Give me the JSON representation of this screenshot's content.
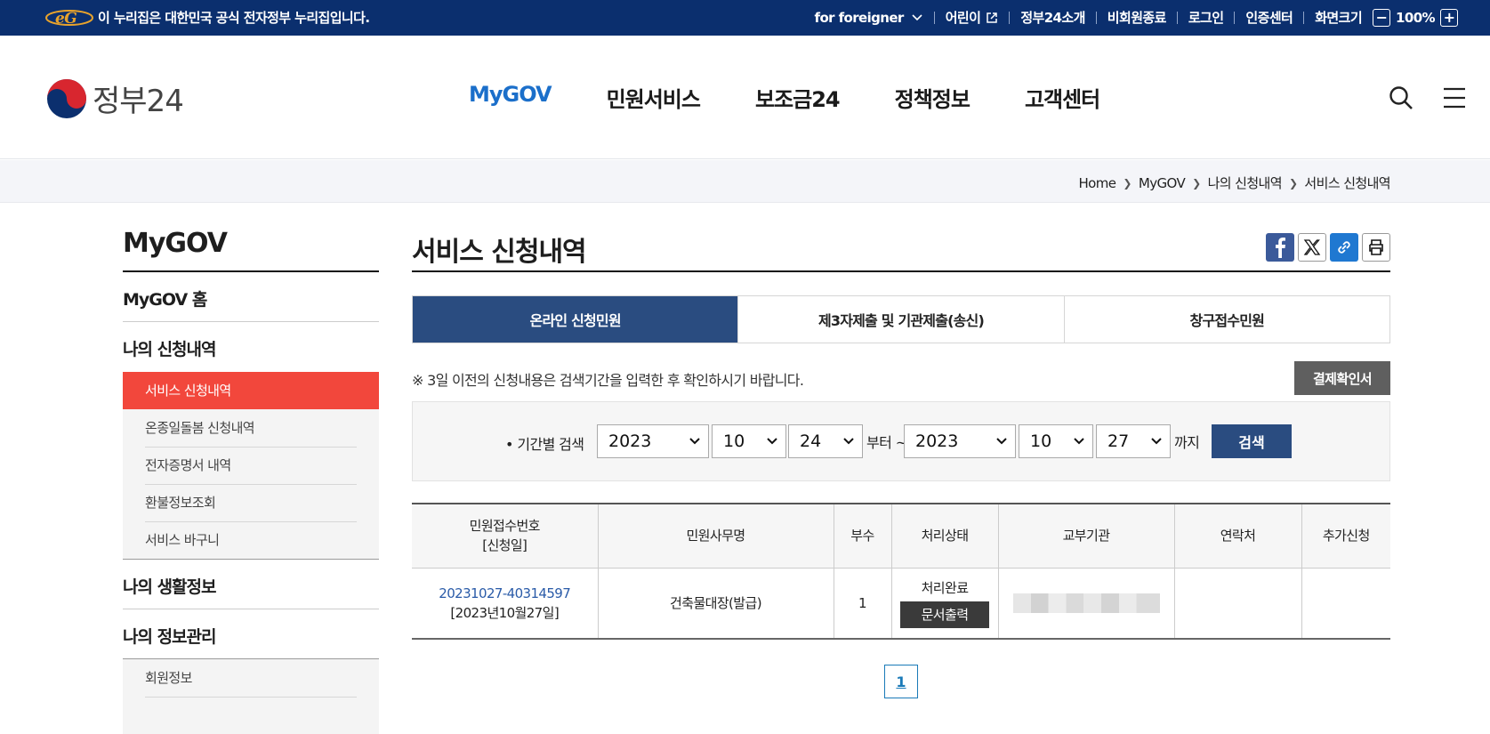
{
  "topbar": {
    "notice": "이 누리집은 대한민국 공식 전자정부 누리집입니다.",
    "items": {
      "foreigner": "for foreigner",
      "kids": "어린이",
      "about": "정부24소개",
      "guest_end": "비회원종료",
      "login": "로그인",
      "cert": "인증센터",
      "zoom_label": "화면크기",
      "zoom_value": "100%"
    }
  },
  "header": {
    "brand": "정부24",
    "gnb": [
      "MyGOV",
      "민원서비스",
      "보조금24",
      "정책정보",
      "고객센터"
    ]
  },
  "breadcrumb": [
    "Home",
    "MyGOV",
    "나의 신청내역",
    "서비스 신청내역"
  ],
  "lnb": {
    "title": "MyGOV",
    "home": "MyGOV 홈",
    "apply_heading": "나의 신청내역",
    "apply_items": [
      "서비스 신청내역",
      "온종일돌봄 신청내역",
      "전자증명서 내역",
      "환불정보조회",
      "서비스 바구니"
    ],
    "life_heading": "나의 생활정보",
    "info_heading": "나의 정보관리",
    "info_items": [
      "회원정보"
    ]
  },
  "content": {
    "title": "서비스 신청내역",
    "tabs": [
      "온라인 신청민원",
      "제3자제출 및 기관제출(송신)",
      "창구접수민원"
    ],
    "notice": "※ 3일 이전의 신청내용은 검색기간을 입력한 후 확인하시기 바랍니다.",
    "pay_button": "결제확인서",
    "search": {
      "label": "• 기간별 검색",
      "from_year": "2023",
      "from_month": "10",
      "from_day": "24",
      "from_text": "부터 ~",
      "to_year": "2023",
      "to_month": "10",
      "to_day": "27",
      "to_text": "까지",
      "button": "검색"
    },
    "table": {
      "headers": [
        "민원접수번호",
        "[신청일]",
        "민원사무명",
        "부수",
        "처리상태",
        "교부기관",
        "연락처",
        "추가신청"
      ],
      "row": {
        "receipt_no": "20231027-40314597",
        "date": "[2023년10월27일]",
        "service": "건축물대장(발급)",
        "copies": "1",
        "status": "처리완료",
        "print_button": "문서출력"
      }
    },
    "page": "1"
  },
  "colors": {
    "topbar": "#0b2f6e",
    "active_nav": "#1b6fca",
    "active_lnb": "#f2473c",
    "tab_active": "#2a4c80"
  }
}
